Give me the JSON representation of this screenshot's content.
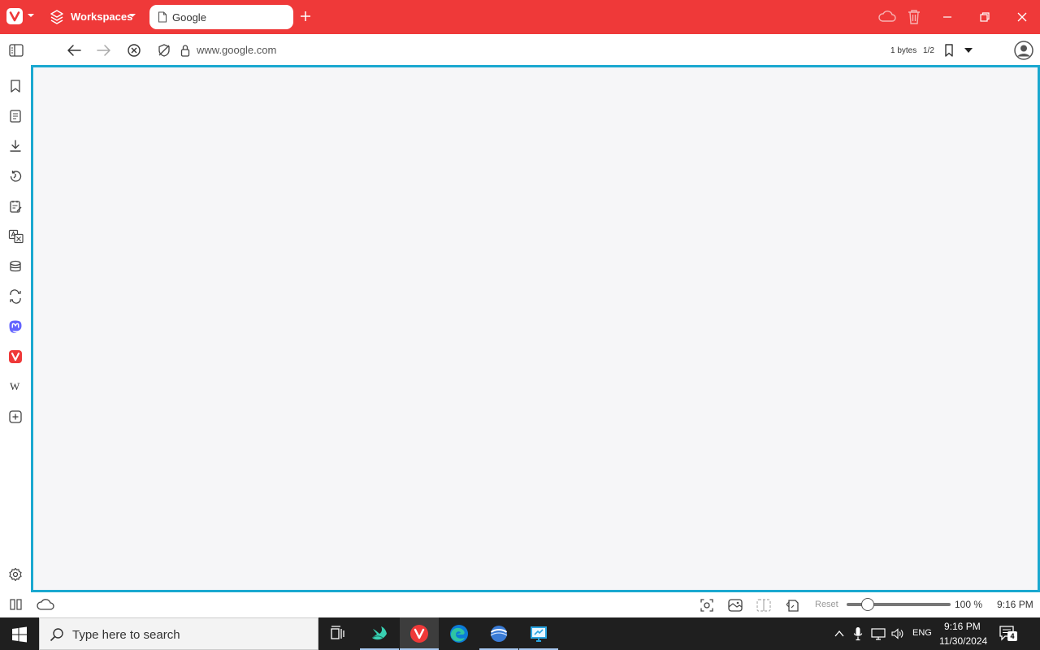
{
  "browser": {
    "workspaces_label": "Workspaces",
    "tab_title": "Google",
    "url": "www.google.com",
    "page_bytes": "1 bytes",
    "page_count": "1/2",
    "accent_color": "#ef3939",
    "focus_border_color": "#1aa8d0"
  },
  "side_panel": {
    "items": [
      "bookmarks-icon",
      "reading-list-icon",
      "downloads-icon",
      "history-icon",
      "notes-icon",
      "translate-icon",
      "window-panel-icon",
      "sync-icon",
      "mastodon-icon",
      "vivaldi-icon",
      "wikipedia-icon",
      "add-web-panel-icon"
    ],
    "wiki_letter": "W"
  },
  "statusbar": {
    "reset_label": "Reset",
    "zoom_label": "100 %",
    "zoom_percent": 100,
    "clock": "9:16 PM"
  },
  "taskbar": {
    "search_placeholder": "Type here to search",
    "language": "ENG",
    "time": "9:16 PM",
    "date": "11/30/2024",
    "notification_count": "4"
  }
}
